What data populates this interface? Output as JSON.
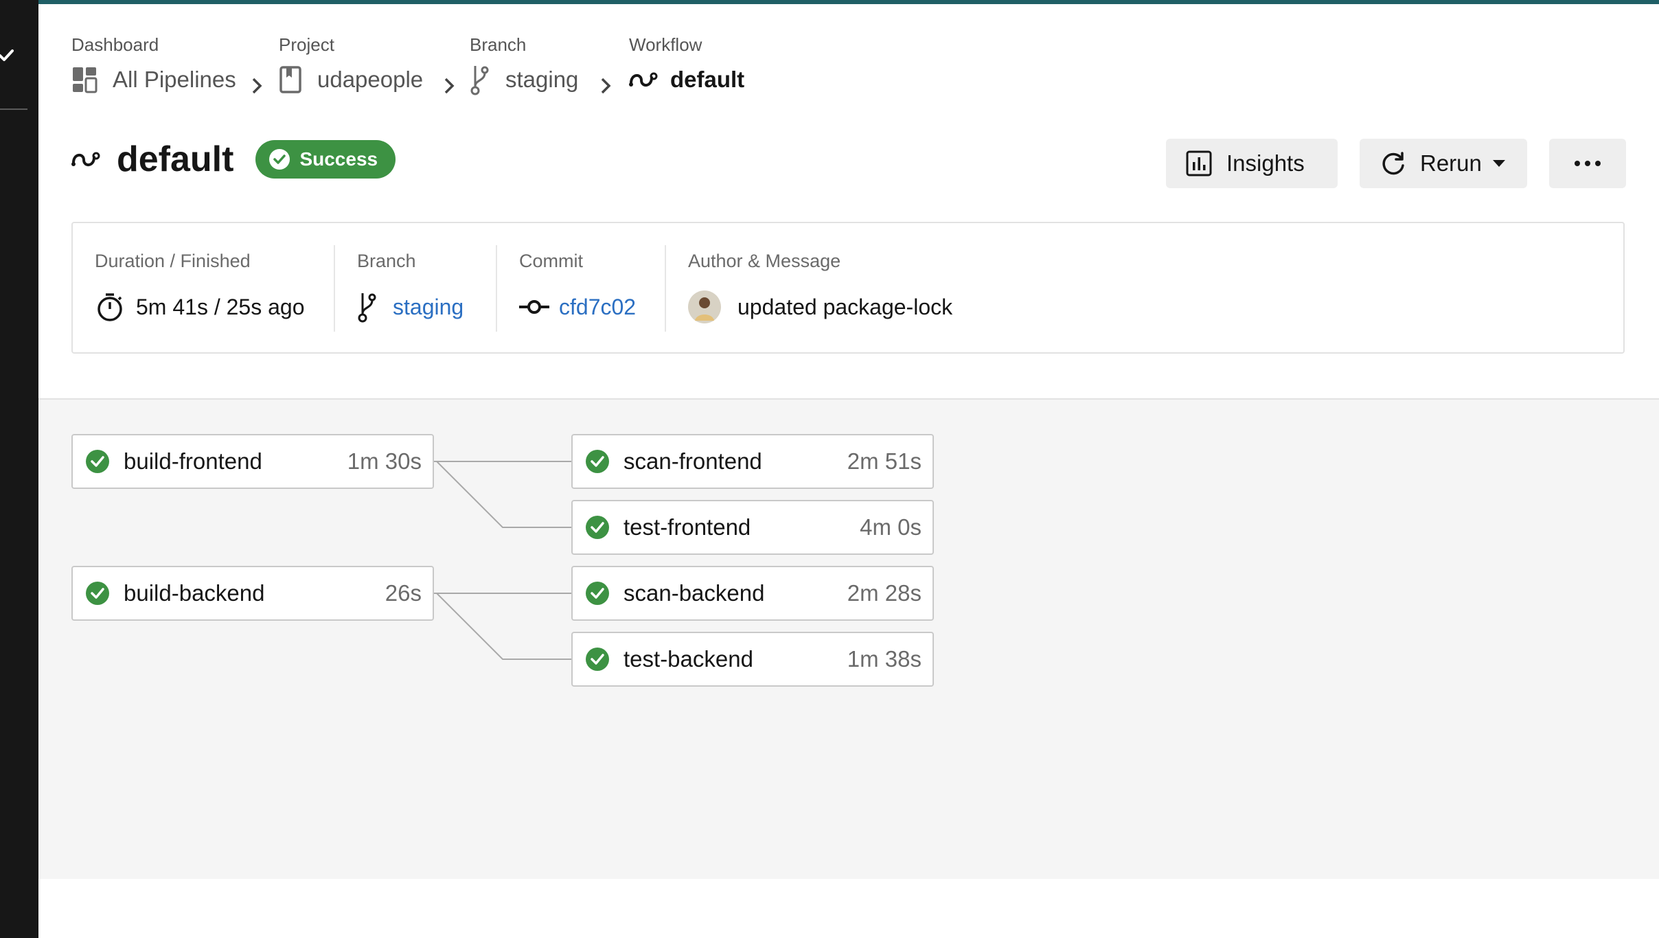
{
  "breadcrumb": [
    {
      "label": "Dashboard",
      "value": "All Pipelines",
      "icon": "dashboard-icon"
    },
    {
      "label": "Project",
      "value": "udapeople",
      "icon": "project-icon"
    },
    {
      "label": "Branch",
      "value": "staging",
      "icon": "branch-icon"
    },
    {
      "label": "Workflow",
      "value": "default",
      "icon": "workflow-icon"
    }
  ],
  "workflow": {
    "title": "default",
    "status": "Success",
    "status_color": "#3d9243"
  },
  "actions": {
    "insights_label": "Insights",
    "rerun_label": "Rerun",
    "more_label": "•••"
  },
  "summary": {
    "duration_label": "Duration / Finished",
    "duration_value": "5m 41s / 25s ago",
    "branch_label": "Branch",
    "branch_value": "staging",
    "commit_label": "Commit",
    "commit_value": "cfd7c02",
    "author_label": "Author & Message",
    "message": "updated package-lock"
  },
  "jobs": [
    {
      "name": "build-frontend",
      "duration": "1m 30s",
      "status": "success"
    },
    {
      "name": "scan-frontend",
      "duration": "2m 51s",
      "status": "success"
    },
    {
      "name": "test-frontend",
      "duration": "4m 0s",
      "status": "success"
    },
    {
      "name": "build-backend",
      "duration": "26s",
      "status": "success"
    },
    {
      "name": "scan-backend",
      "duration": "2m 28s",
      "status": "success"
    },
    {
      "name": "test-backend",
      "duration": "1m 38s",
      "status": "success"
    }
  ],
  "colors": {
    "accent_link": "#2b6fc2",
    "success": "#3d9243",
    "sidebar": "#171717",
    "top_bar": "#1f5f66"
  }
}
